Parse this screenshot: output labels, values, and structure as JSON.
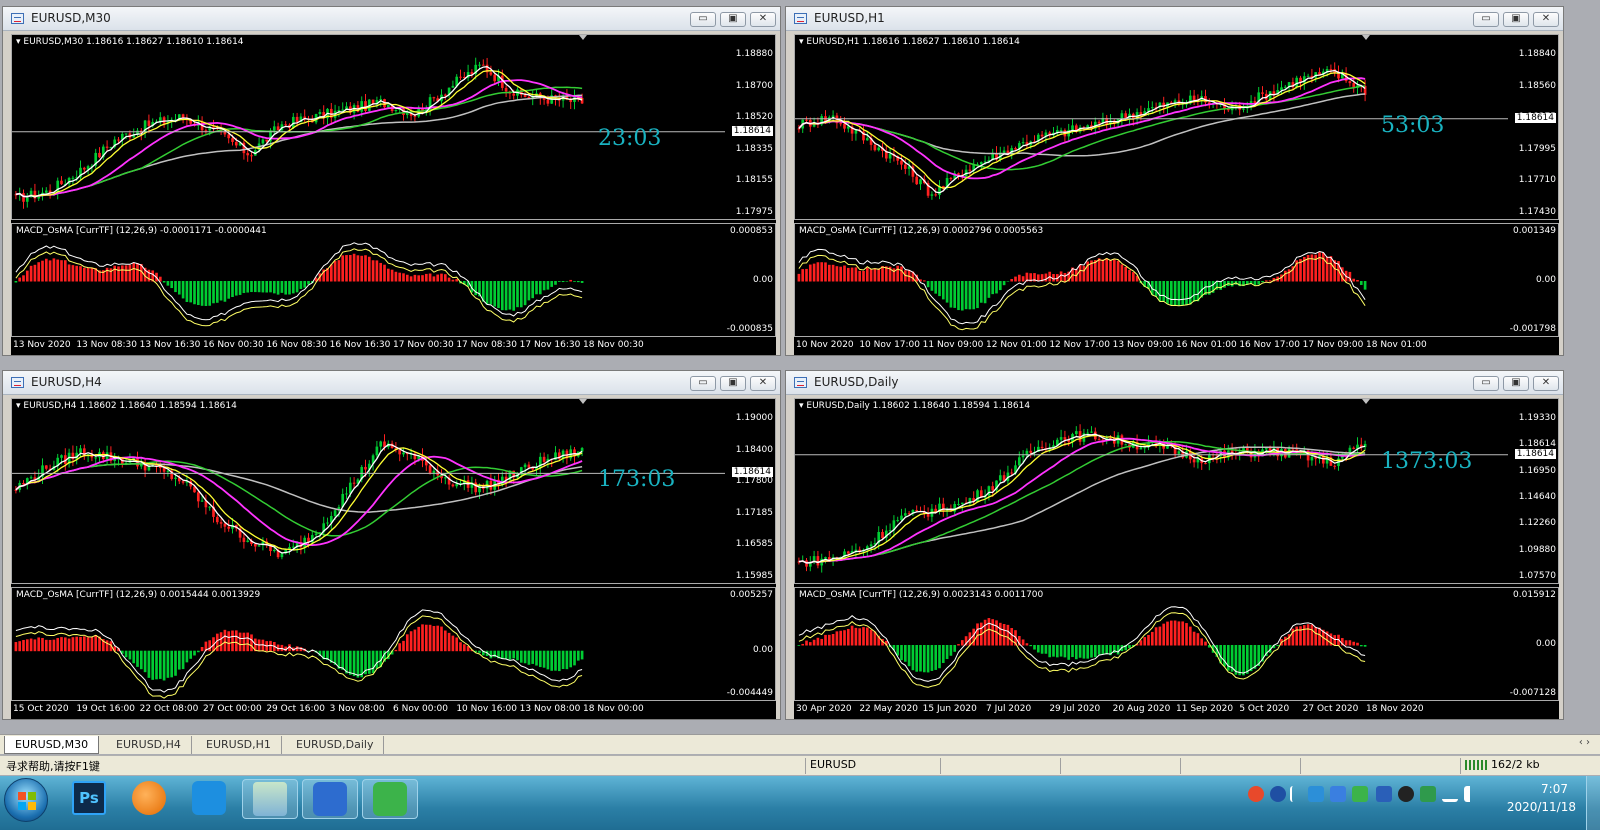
{
  "windows": [
    {
      "title": "EURUSD,M30",
      "info": "EURUSD,M30  1.18616 1.18627 1.18610 1.18614",
      "timer": "23:03",
      "price_labels": [
        "1.18880",
        "1.18700",
        "1.18520",
        "1.18335",
        "1.18155",
        "1.17975"
      ],
      "current_price": "1.18614",
      "indicator": "MACD_OsMA [CurrTF] (12,26,9) -0.0001171 -0.0000441",
      "indicator_levels": [
        "0.000853",
        "0.00",
        "-0.000835"
      ],
      "time_labels": [
        "13 Nov 2020",
        "13 Nov 08:30",
        "13 Nov 16:30",
        "16 Nov 00:30",
        "16 Nov 08:30",
        "16 Nov 16:30",
        "17 Nov 00:30",
        "17 Nov 08:30",
        "17 Nov 16:30",
        "18 Nov 00:30"
      ]
    },
    {
      "title": "EURUSD,H1",
      "info": "EURUSD,H1  1.18616 1.18627 1.18610 1.18614",
      "timer": "53:03",
      "price_labels": [
        "1.18840",
        "1.18560",
        "1.18275",
        "1.17995",
        "1.17710",
        "1.17430"
      ],
      "current_price": "1.18614",
      "indicator": "MACD_OsMA [CurrTF] (12,26,9) 0.0002796 0.0005563",
      "indicator_levels": [
        "0.001349",
        "0.00",
        "-0.001798"
      ],
      "time_labels": [
        "10 Nov 2020",
        "10 Nov 17:00",
        "11 Nov 09:00",
        "12 Nov 01:00",
        "12 Nov 17:00",
        "13 Nov 09:00",
        "16 Nov 01:00",
        "16 Nov 17:00",
        "17 Nov 09:00",
        "18 Nov 01:00"
      ]
    },
    {
      "title": "EURUSD,H4",
      "info": "EURUSD,H4  1.18602 1.18640 1.18594 1.18614",
      "timer": "173:03",
      "price_labels": [
        "1.19000",
        "1.18400",
        "1.17800",
        "1.17185",
        "1.16585",
        "1.15985"
      ],
      "current_price": "1.18614",
      "indicator": "MACD_OsMA [CurrTF] (12,26,9) 0.0015444 0.0013929",
      "indicator_levels": [
        "0.005257",
        "0.00",
        "-0.004449"
      ],
      "time_labels": [
        "15 Oct 2020",
        "19 Oct 16:00",
        "22 Oct 08:00",
        "27 Oct 00:00",
        "29 Oct 16:00",
        "3 Nov 08:00",
        "6 Nov 00:00",
        "10 Nov 16:00",
        "13 Nov 08:00",
        "18 Nov 00:00"
      ]
    },
    {
      "title": "EURUSD,Daily",
      "info": "EURUSD,Daily  1.18602 1.18640 1.18594 1.18614",
      "timer": "1373:03",
      "price_labels": [
        "1.19330",
        "1.18614",
        "1.16950",
        "1.14640",
        "1.12260",
        "1.09880",
        "1.07570"
      ],
      "current_price": "1.18614",
      "indicator": "MACD_OsMA [CurrTF] (12,26,9) 0.0023143 0.0011700",
      "indicator_levels": [
        "0.015912",
        "0.00",
        "-0.007128"
      ],
      "time_labels": [
        "30 Apr 2020",
        "22 May 2020",
        "15 Jun 2020",
        "7 Jul 2020",
        "29 Jul 2020",
        "20 Aug 2020",
        "11 Sep 2020",
        "5 Oct 2020",
        "27 Oct 2020",
        "18 Nov 2020"
      ]
    }
  ],
  "tabs": [
    "EURUSD,M30",
    "EURUSD,H4",
    "EURUSD,H1",
    "EURUSD,Daily"
  ],
  "active_tab": "EURUSD,M30",
  "tab_scroll": "‹ ›",
  "window_buttons": {
    "minimize": "▭",
    "maximize": "▣",
    "close": "✕"
  },
  "status": {
    "help": "寻求帮助,请按F1键",
    "symbol": "EURUSD",
    "traffic": "162/2 kb"
  },
  "taskbar": {
    "apps": [
      "start-orb",
      "photoshop",
      "app-orange",
      "app-blue",
      "app-users",
      "wps",
      "wechat"
    ],
    "ps_label": "Ps",
    "time": "7:07",
    "date": "2020/11/18"
  },
  "colors": {
    "bull": "#00cc33",
    "bear": "#ff2020",
    "ma_fast": "#ffffff",
    "ma_yellow": "#ffff33",
    "ma_magenta": "#ff33ff",
    "ma_green": "#33cc33",
    "ma_grey": "#c0c0c0",
    "timer": "#19b3c1"
  }
}
